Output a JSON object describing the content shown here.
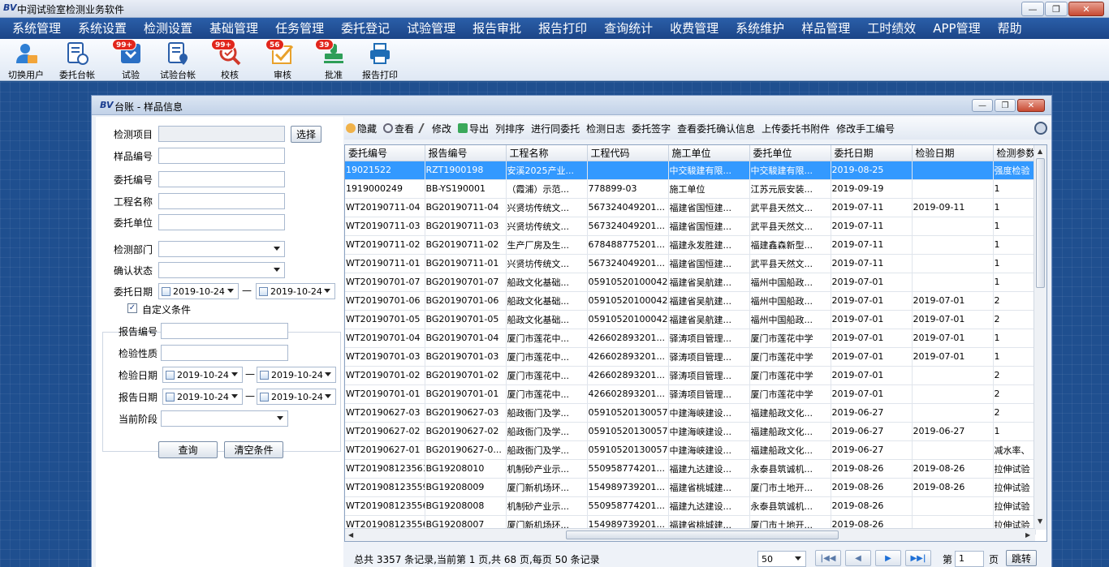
{
  "app": {
    "logo": "BV",
    "title": "中润试验室检测业务软件"
  },
  "window_controls": {
    "minimize": "—",
    "restore": "❐",
    "close": "✕"
  },
  "menu": [
    "系统管理",
    "系统设置",
    "检测设置",
    "基础管理",
    "任务管理",
    "委托登记",
    "试验管理",
    "报告审批",
    "报告打印",
    "查询统计",
    "收费管理",
    "系统维护",
    "样品管理",
    "工时绩效",
    "APP管理",
    "帮助"
  ],
  "toolbar": [
    {
      "label": "切换用户",
      "icon": "switch-user-icon",
      "badge": ""
    },
    {
      "label": "委托台帐",
      "icon": "entrust-ledger-icon",
      "badge": ""
    },
    {
      "label": "试验",
      "icon": "test-icon",
      "badge": "99+"
    },
    {
      "label": "试验台帐",
      "icon": "test-ledger-icon",
      "badge": ""
    },
    {
      "label": "校核",
      "icon": "verify-icon",
      "badge": "99+"
    },
    {
      "label": "审核",
      "icon": "review-icon",
      "badge": "56"
    },
    {
      "label": "批准",
      "icon": "approve-icon",
      "badge": "39"
    },
    {
      "label": "报告打印",
      "icon": "print-icon",
      "badge": ""
    }
  ],
  "child_window": {
    "logo": "BV",
    "title": "台账 - 样品信息"
  },
  "form": {
    "test_item": "检测项目",
    "select_button": "选择",
    "sample_no": "样品编号",
    "entrust_no": "委托编号",
    "project_name": "工程名称",
    "entrust_unit": "委托单位",
    "test_dept": "检测部门",
    "confirm_status": "确认状态",
    "entrust_date": "委托日期",
    "entrust_date_from": "2019-10-24",
    "entrust_date_to": "2019-10-24",
    "range_dash": "—",
    "custom_condition": "自定义条件",
    "custom_checked": "✓",
    "report_no": "报告编号",
    "inspect_nature": "检验性质",
    "inspect_date": "检验日期",
    "inspect_date_from": "2019-10-24",
    "inspect_date_to": "2019-10-24",
    "report_date": "报告日期",
    "report_date_from": "2019-10-24",
    "report_date_to": "2019-10-24",
    "current_stage": "当前阶段",
    "query_button": "查询",
    "clear_button": "清空条件"
  },
  "grid_toolbar": [
    "隐藏",
    "查看",
    "修改",
    "导出",
    "列排序",
    "进行同委托",
    "检测日志",
    "委托签字",
    "查看委托确认信息",
    "上传委托书附件",
    "修改手工编号"
  ],
  "grid": {
    "columns": [
      "委托编号",
      "报告编号",
      "工程名称",
      "工程代码",
      "施工单位",
      "委托单位",
      "委托日期",
      "检验日期",
      "检测参数"
    ],
    "rows": [
      [
        "19021522",
        "RZT1900198",
        "安溪2025产业...",
        "",
        "中交駿建有限...",
        "中交駿建有限...",
        "2019-08-25",
        "",
        "强度检验"
      ],
      [
        "1919000249",
        "BB-YS190001",
        "（霞浦）示范...",
        "778899-03",
        "施工单位",
        "江苏元辰安装...",
        "2019-09-19",
        "",
        "1"
      ],
      [
        "WT20190711-04",
        "BG20190711-04",
        "兴贤坊传统文...",
        "567324049201...",
        "福建省国恒建...",
        "武平县天然文...",
        "2019-07-11",
        "2019-09-11",
        "1"
      ],
      [
        "WT20190711-03",
        "BG20190711-03",
        "兴贤坊传统文...",
        "567324049201...",
        "福建省国恒建...",
        "武平县天然文...",
        "2019-07-11",
        "",
        "1"
      ],
      [
        "WT20190711-02",
        "BG20190711-02",
        "生产厂房及生...",
        "678488775201...",
        "福建永发胜建...",
        "福建鑫森新型...",
        "2019-07-11",
        "",
        "1"
      ],
      [
        "WT20190711-01",
        "BG20190711-01",
        "兴贤坊传统文...",
        "567324049201...",
        "福建省国恒建...",
        "武平县天然文...",
        "2019-07-11",
        "",
        "1"
      ],
      [
        "WT20190701-07",
        "BG20190701-07",
        "船政文化基础...",
        "05910520100042",
        "福建省吴航建...",
        "福州中国船政...",
        "2019-07-01",
        "",
        "1"
      ],
      [
        "WT20190701-06",
        "BG20190701-06",
        "船政文化基础...",
        "05910520100042",
        "福建省吴航建...",
        "福州中国船政...",
        "2019-07-01",
        "2019-07-01",
        "2"
      ],
      [
        "WT20190701-05",
        "BG20190701-05",
        "船政文化基础...",
        "05910520100042",
        "福建省吴航建...",
        "福州中国船政...",
        "2019-07-01",
        "2019-07-01",
        "2"
      ],
      [
        "WT20190701-04",
        "BG20190701-04",
        "厦门市莲花中...",
        "426602893201...",
        "驿涛项目管理...",
        "厦门市莲花中学",
        "2019-07-01",
        "2019-07-01",
        "1"
      ],
      [
        "WT20190701-03",
        "BG20190701-03",
        "厦门市莲花中...",
        "426602893201...",
        "驿涛项目管理...",
        "厦门市莲花中学",
        "2019-07-01",
        "2019-07-01",
        "1"
      ],
      [
        "WT20190701-02",
        "BG20190701-02",
        "厦门市莲花中...",
        "426602893201...",
        "驿涛项目管理...",
        "厦门市莲花中学",
        "2019-07-01",
        "",
        "2"
      ],
      [
        "WT20190701-01",
        "BG20190701-01",
        "厦门市莲花中...",
        "426602893201...",
        "驿涛项目管理...",
        "厦门市莲花中学",
        "2019-07-01",
        "",
        "2"
      ],
      [
        "WT20190627-03",
        "BG20190627-03",
        "船政衙门及学...",
        "05910520130057",
        "中建海峡建设...",
        "福建船政文化...",
        "2019-06-27",
        "",
        "2"
      ],
      [
        "WT20190627-02",
        "BG20190627-02",
        "船政衙门及学...",
        "05910520130057",
        "中建海峡建设...",
        "福建船政文化...",
        "2019-06-27",
        "2019-06-27",
        "1"
      ],
      [
        "WT20190627-01",
        "BG20190627-0...",
        "船政衙门及学...",
        "05910520130057",
        "中建海峡建设...",
        "福建船政文化...",
        "2019-06-27",
        "",
        "减水率、"
      ],
      [
        "WT2019081235616",
        "BG19208010",
        "机制砂产业示...",
        "550958774201...",
        "福建九达建设...",
        "永泰县筑诚机...",
        "2019-08-26",
        "2019-08-26",
        "拉伸试验"
      ],
      [
        "WT2019081235597",
        "BG19208009",
        "厦门新机场环...",
        "154989739201...",
        "福建省桃城建...",
        "厦门市土地开...",
        "2019-08-26",
        "2019-08-26",
        "拉伸试验"
      ],
      [
        "WT2019081235567",
        "BG19208008",
        "机制砂产业示...",
        "550958774201...",
        "福建九达建设...",
        "永泰县筑诚机...",
        "2019-08-26",
        "",
        "拉伸试验"
      ],
      [
        "WT2019081235565",
        "BG19208007",
        "厦门新机场环...",
        "154989739201...",
        "福建省桃城建...",
        "厦门市土地开...",
        "2019-08-26",
        "",
        "拉伸试验"
      ]
    ],
    "selected_row": 0
  },
  "pager": {
    "summary": "总共 3357 条记录,当前第 1 页,共 68 页,每页 50 条记录",
    "page_size": "50",
    "page_label_pre": "第",
    "page_value": "1",
    "page_label_post": "页",
    "jump_button": "跳转"
  },
  "colors": {
    "menubar": "#1c4587",
    "selected_row": "#3399ff",
    "badge": "#e1261c"
  }
}
